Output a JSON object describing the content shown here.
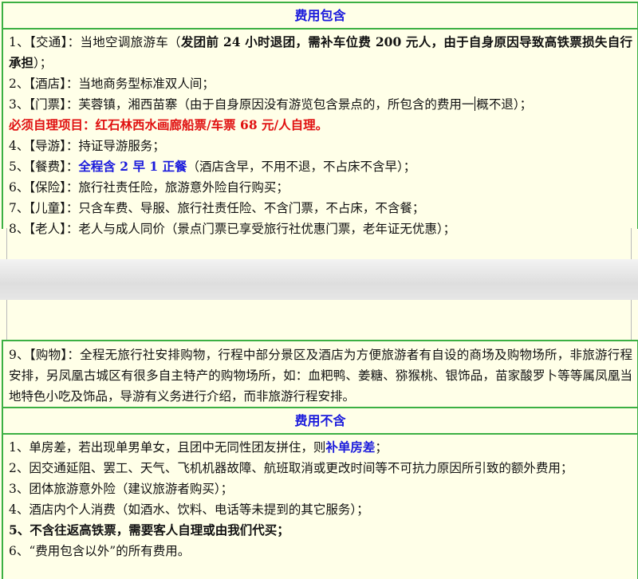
{
  "include": {
    "title": "费用包含",
    "item1_a": "1、【交通】：当地空调旅游车（",
    "item1_b": "发团前 24 小时退团，需补车位费 200 元人，由于自身原因导致高铁票损失自行承担",
    "item1_c": "）；",
    "item2": "2、【酒店】：当地商务型标准双人间；",
    "item3_a": "3、【门票】：芙蓉镇，湘西苗寨（由于自身原因没有游览包含景点的，所包含的费用一",
    "item3_b": "概不退）；",
    "must": "必须自理项目：红石林西水画廊船票/车票 68 元/人自理。",
    "item4": "4、【导游】：持证导游服务；",
    "item5_a": "5、【餐费】：",
    "item5_b": "全程含 2 早 1 正餐",
    "item5_c": "（酒店含早，不用不退，不占床不含早）；",
    "item6": "6、【保险】：旅行社责任险，旅游意外险自行购买；",
    "item7": "7、【儿童】：只含车费、导服、旅行社责任险、不含门票，不占床，不含餐；",
    "item8": "8、【老人】：老人与成人同价（景点门票已享受旅行社优惠门票，老年证无优惠）；",
    "item9": "9、【购物】：全程无旅行社安排购物，行程中部分景区及酒店为方便旅游者有自设的商场及购物场所，非旅游行程安排，另凤凰古城区有很多自主特产的购物场所，如：血粑鸭、姜糖、猕猴桃、银饰品，苗家酸罗卜等等属凤凰当地特色小吃及饰品，导游有义务进行介绍，而非旅游行程安排。"
  },
  "exclude": {
    "title": "费用不含",
    "item1_a": "1、单房差，若出现单男单女，且团中无同性团友拼住，则",
    "item1_b": "补单房差",
    "item1_c": "；",
    "item2": "2、因交通延阻、罢工、天气、飞机机器故障、航班取消或更改时间等不可抗力原因所引致的额外费用；",
    "item3": "3、团体旅游意外险（建议旅游者购买）；",
    "item4": "4、酒店内个人消费（如酒水、饮料、电话等未提到的其它服务）；",
    "item5": "5、不含往返高铁票，需要客人自理或由我们代买；",
    "item6": "6、“费用包含以外”的所有费用。"
  },
  "colors": {
    "border": "#3cb043",
    "header": "#1a1adc",
    "highlight_red": "#e01010",
    "background": "#ffffe8"
  }
}
